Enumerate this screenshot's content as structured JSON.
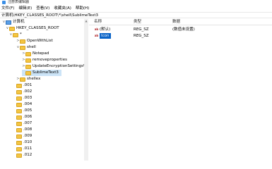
{
  "window": {
    "title": "注册表编辑器"
  },
  "menu": [
    "文件(F)",
    "编辑(E)",
    "查看(V)",
    "收藏夹(A)",
    "帮助(H)"
  ],
  "address": "计算机\\HKEY_CLASSES_ROOT\\*\\shell\\SublimeText3",
  "tree": [
    {
      "label": "计算机",
      "chev": "∨",
      "icon": "computer-icon"
    },
    {
      "label": "HKEY_CLASSES_ROOT",
      "chev": "∨",
      "icon": "folder-icon"
    },
    {
      "label": "*",
      "chev": "∨",
      "icon": "folder-icon"
    },
    {
      "label": "OpenWithList",
      "chev": ">",
      "icon": "folder-icon"
    },
    {
      "label": "shell",
      "chev": "∨",
      "icon": "folder-icon"
    },
    {
      "label": "Notepad",
      "chev": ">",
      "icon": "folder-icon"
    },
    {
      "label": "removeproperties",
      "chev": ">",
      "icon": "folder-icon"
    },
    {
      "label": "UpdateEncryptionSettingsW",
      "chev": ">",
      "icon": "folder-icon"
    },
    {
      "label": "SublimeText3",
      "chev": "",
      "icon": "folder-icon"
    },
    {
      "label": "shellex",
      "chev": ">",
      "icon": "folder-icon"
    },
    {
      "label": ".001",
      "chev": "",
      "icon": "folder-icon"
    },
    {
      "label": ".002",
      "chev": "",
      "icon": "folder-icon"
    },
    {
      "label": ".003",
      "chev": "",
      "icon": "folder-icon"
    },
    {
      "label": ".004",
      "chev": "",
      "icon": "folder-icon"
    },
    {
      "label": ".005",
      "chev": "",
      "icon": "folder-icon"
    },
    {
      "label": ".006",
      "chev": "",
      "icon": "folder-icon"
    },
    {
      "label": ".007",
      "chev": "",
      "icon": "folder-icon"
    },
    {
      "label": ".008",
      "chev": "",
      "icon": "folder-icon"
    },
    {
      "label": ".009",
      "chev": "",
      "icon": "folder-icon"
    },
    {
      "label": ".010",
      "chev": "",
      "icon": "folder-icon"
    },
    {
      "label": ".011",
      "chev": "",
      "icon": "folder-icon"
    },
    {
      "label": ".012",
      "chev": "",
      "icon": "folder-icon"
    }
  ],
  "list": {
    "headers": [
      "名称",
      "类型",
      "数据"
    ],
    "rows": [
      {
        "icon": "ab",
        "name": "(默认)",
        "type": "REG_SZ",
        "data": "(数值未设置)"
      },
      {
        "icon": "ab",
        "name": "Icon",
        "type": "REG_SZ",
        "data": ""
      }
    ]
  }
}
